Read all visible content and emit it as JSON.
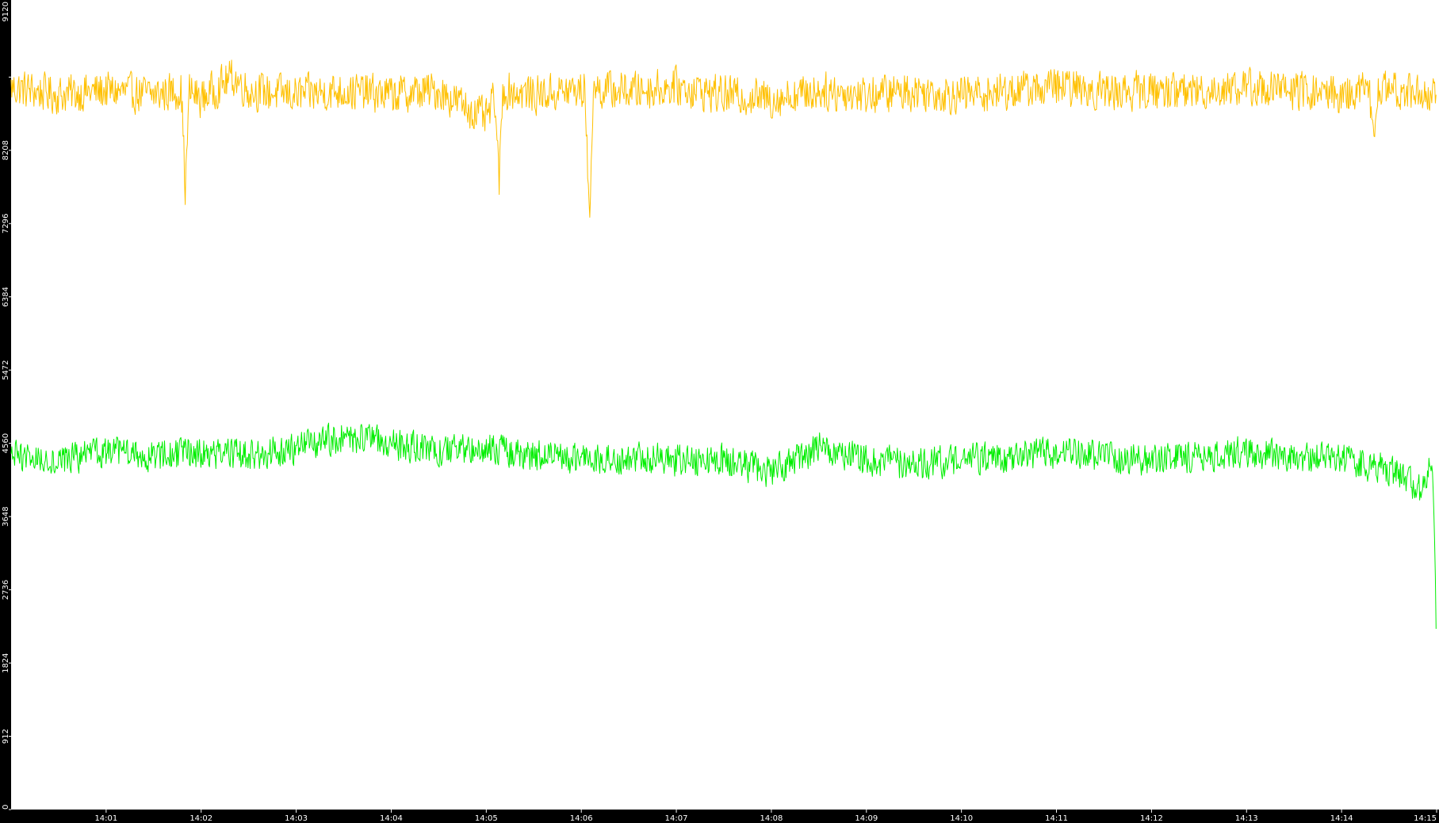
{
  "chart_data": {
    "type": "line",
    "title": "",
    "xlabel": "",
    "ylabel": "",
    "x_range": [
      "14:00",
      "14:15"
    ],
    "ylim": [
      0,
      10080
    ],
    "y_ticks": [
      0,
      912,
      1824,
      2736,
      3648,
      4560,
      5472,
      6384,
      7296,
      8208,
      9120
    ],
    "x_ticks": [
      "14:01",
      "14:02",
      "14:03",
      "14:04",
      "14:05",
      "14:06",
      "14:07",
      "14:08",
      "14:09",
      "14:10",
      "14:11",
      "14:12",
      "14:13",
      "14:14",
      "14:15"
    ],
    "grid": false,
    "legend": "none",
    "background_color": "#ffffff",
    "axis_strip_color": "#000000",
    "axis_text_color": "#ffffff",
    "series": [
      {
        "color": "#ffc000",
        "baseline": 8970,
        "noise": 230,
        "points": [
          {
            "x": "14:00:00",
            "y": 8990
          },
          {
            "x": "14:00:30",
            "y": 8900
          },
          {
            "x": "14:01:00",
            "y": 8950
          },
          {
            "x": "14:01:30",
            "y": 8900
          },
          {
            "x": "14:01:50",
            "y": 7700
          },
          {
            "x": "14:02:00",
            "y": 8850
          },
          {
            "x": "14:02:20",
            "y": 9120
          },
          {
            "x": "14:02:30",
            "y": 8950
          },
          {
            "x": "14:03:00",
            "y": 8900
          },
          {
            "x": "14:03:30",
            "y": 8950
          },
          {
            "x": "14:04:00",
            "y": 8900
          },
          {
            "x": "14:04:30",
            "y": 8950
          },
          {
            "x": "14:05:00",
            "y": 8600
          },
          {
            "x": "14:05:08",
            "y": 7750
          },
          {
            "x": "14:05:30",
            "y": 8900
          },
          {
            "x": "14:06:05",
            "y": 7250
          },
          {
            "x": "14:06:30",
            "y": 8950
          },
          {
            "x": "14:07:00",
            "y": 9000
          },
          {
            "x": "14:07:30",
            "y": 8900
          },
          {
            "x": "14:08:00",
            "y": 8850
          },
          {
            "x": "14:08:30",
            "y": 8950
          },
          {
            "x": "14:09:00",
            "y": 8900
          },
          {
            "x": "14:09:30",
            "y": 8950
          },
          {
            "x": "14:10:00",
            "y": 8900
          },
          {
            "x": "14:10:30",
            "y": 8950
          },
          {
            "x": "14:11:00",
            "y": 9000
          },
          {
            "x": "14:11:30",
            "y": 8950
          },
          {
            "x": "14:12:00",
            "y": 8950
          },
          {
            "x": "14:12:30",
            "y": 8950
          },
          {
            "x": "14:13:00",
            "y": 9000
          },
          {
            "x": "14:13:30",
            "y": 8950
          },
          {
            "x": "14:14:00",
            "y": 8900
          },
          {
            "x": "14:14:20",
            "y": 8300
          },
          {
            "x": "14:14:40",
            "y": 8950
          },
          {
            "x": "14:15:00",
            "y": 8900
          }
        ]
      },
      {
        "color": "#00ee00",
        "baseline": 4420,
        "noise": 190,
        "points": [
          {
            "x": "14:00:00",
            "y": 4400
          },
          {
            "x": "14:00:30",
            "y": 4350
          },
          {
            "x": "14:01:00",
            "y": 4450
          },
          {
            "x": "14:01:30",
            "y": 4400
          },
          {
            "x": "14:02:00",
            "y": 4450
          },
          {
            "x": "14:02:30",
            "y": 4400
          },
          {
            "x": "14:03:00",
            "y": 4500
          },
          {
            "x": "14:03:30",
            "y": 4650
          },
          {
            "x": "14:04:00",
            "y": 4550
          },
          {
            "x": "14:04:30",
            "y": 4450
          },
          {
            "x": "14:05:00",
            "y": 4500
          },
          {
            "x": "14:05:30",
            "y": 4400
          },
          {
            "x": "14:06:00",
            "y": 4350
          },
          {
            "x": "14:06:30",
            "y": 4400
          },
          {
            "x": "14:07:00",
            "y": 4350
          },
          {
            "x": "14:07:30",
            "y": 4350
          },
          {
            "x": "14:08:00",
            "y": 4200
          },
          {
            "x": "14:08:30",
            "y": 4500
          },
          {
            "x": "14:09:00",
            "y": 4350
          },
          {
            "x": "14:09:30",
            "y": 4300
          },
          {
            "x": "14:10:00",
            "y": 4350
          },
          {
            "x": "14:10:30",
            "y": 4400
          },
          {
            "x": "14:11:00",
            "y": 4450
          },
          {
            "x": "14:11:30",
            "y": 4400
          },
          {
            "x": "14:12:00",
            "y": 4350
          },
          {
            "x": "14:12:30",
            "y": 4400
          },
          {
            "x": "14:13:00",
            "y": 4450
          },
          {
            "x": "14:13:30",
            "y": 4400
          },
          {
            "x": "14:14:00",
            "y": 4350
          },
          {
            "x": "14:14:30",
            "y": 4250
          },
          {
            "x": "14:14:50",
            "y": 4000
          },
          {
            "x": "14:15:00",
            "y": 2250
          }
        ]
      }
    ]
  }
}
